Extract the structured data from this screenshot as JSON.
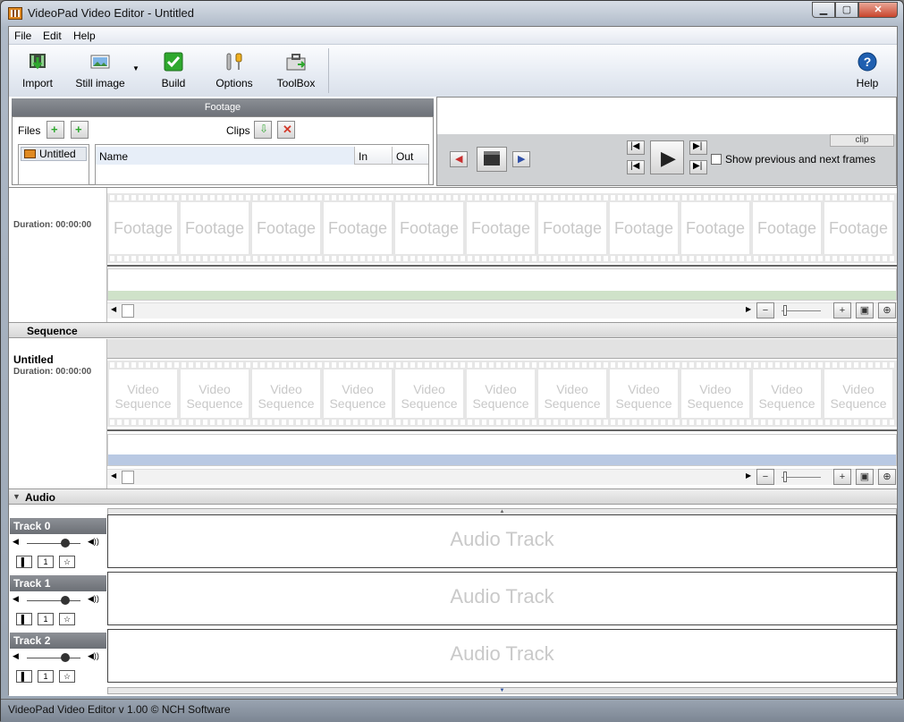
{
  "window": {
    "title": "VideoPad Video Editor - Untitled",
    "min": "▁",
    "max": "▢",
    "close": "✕"
  },
  "menu": [
    "File",
    "Edit",
    "Help"
  ],
  "toolbar": {
    "import": "Import",
    "still_image": "Still image",
    "build": "Build",
    "options": "Options",
    "toolbox": "ToolBox",
    "help": "Help"
  },
  "footage": {
    "header": "Footage",
    "files_label": "Files",
    "clips_label": "Clips",
    "file_item": "Untitled",
    "columns": [
      "Name",
      "In",
      "Out"
    ],
    "duration": "Duration: 00:00:00",
    "frame_label": "Footage"
  },
  "preview": {
    "tab": "clip",
    "show_frames": "Show previous and next frames"
  },
  "sequence": {
    "header": "Sequence",
    "name": "Untitled",
    "duration": "Duration: 00:00:00",
    "frame_line1": "Video",
    "frame_line2": "Sequence"
  },
  "audio": {
    "header": "Audio",
    "track_label": "Audio Track",
    "tracks": [
      {
        "name": "Track 0"
      },
      {
        "name": "Track 1"
      },
      {
        "name": "Track 2"
      }
    ]
  },
  "status": "VideoPad Video Editor v 1.00 © NCH Software",
  "colors": {
    "accent_green": "#2ea82e",
    "delete_red": "#d23a2a",
    "timeline_green": "#cfe2c9",
    "timeline_blue": "#b9c9e3"
  }
}
